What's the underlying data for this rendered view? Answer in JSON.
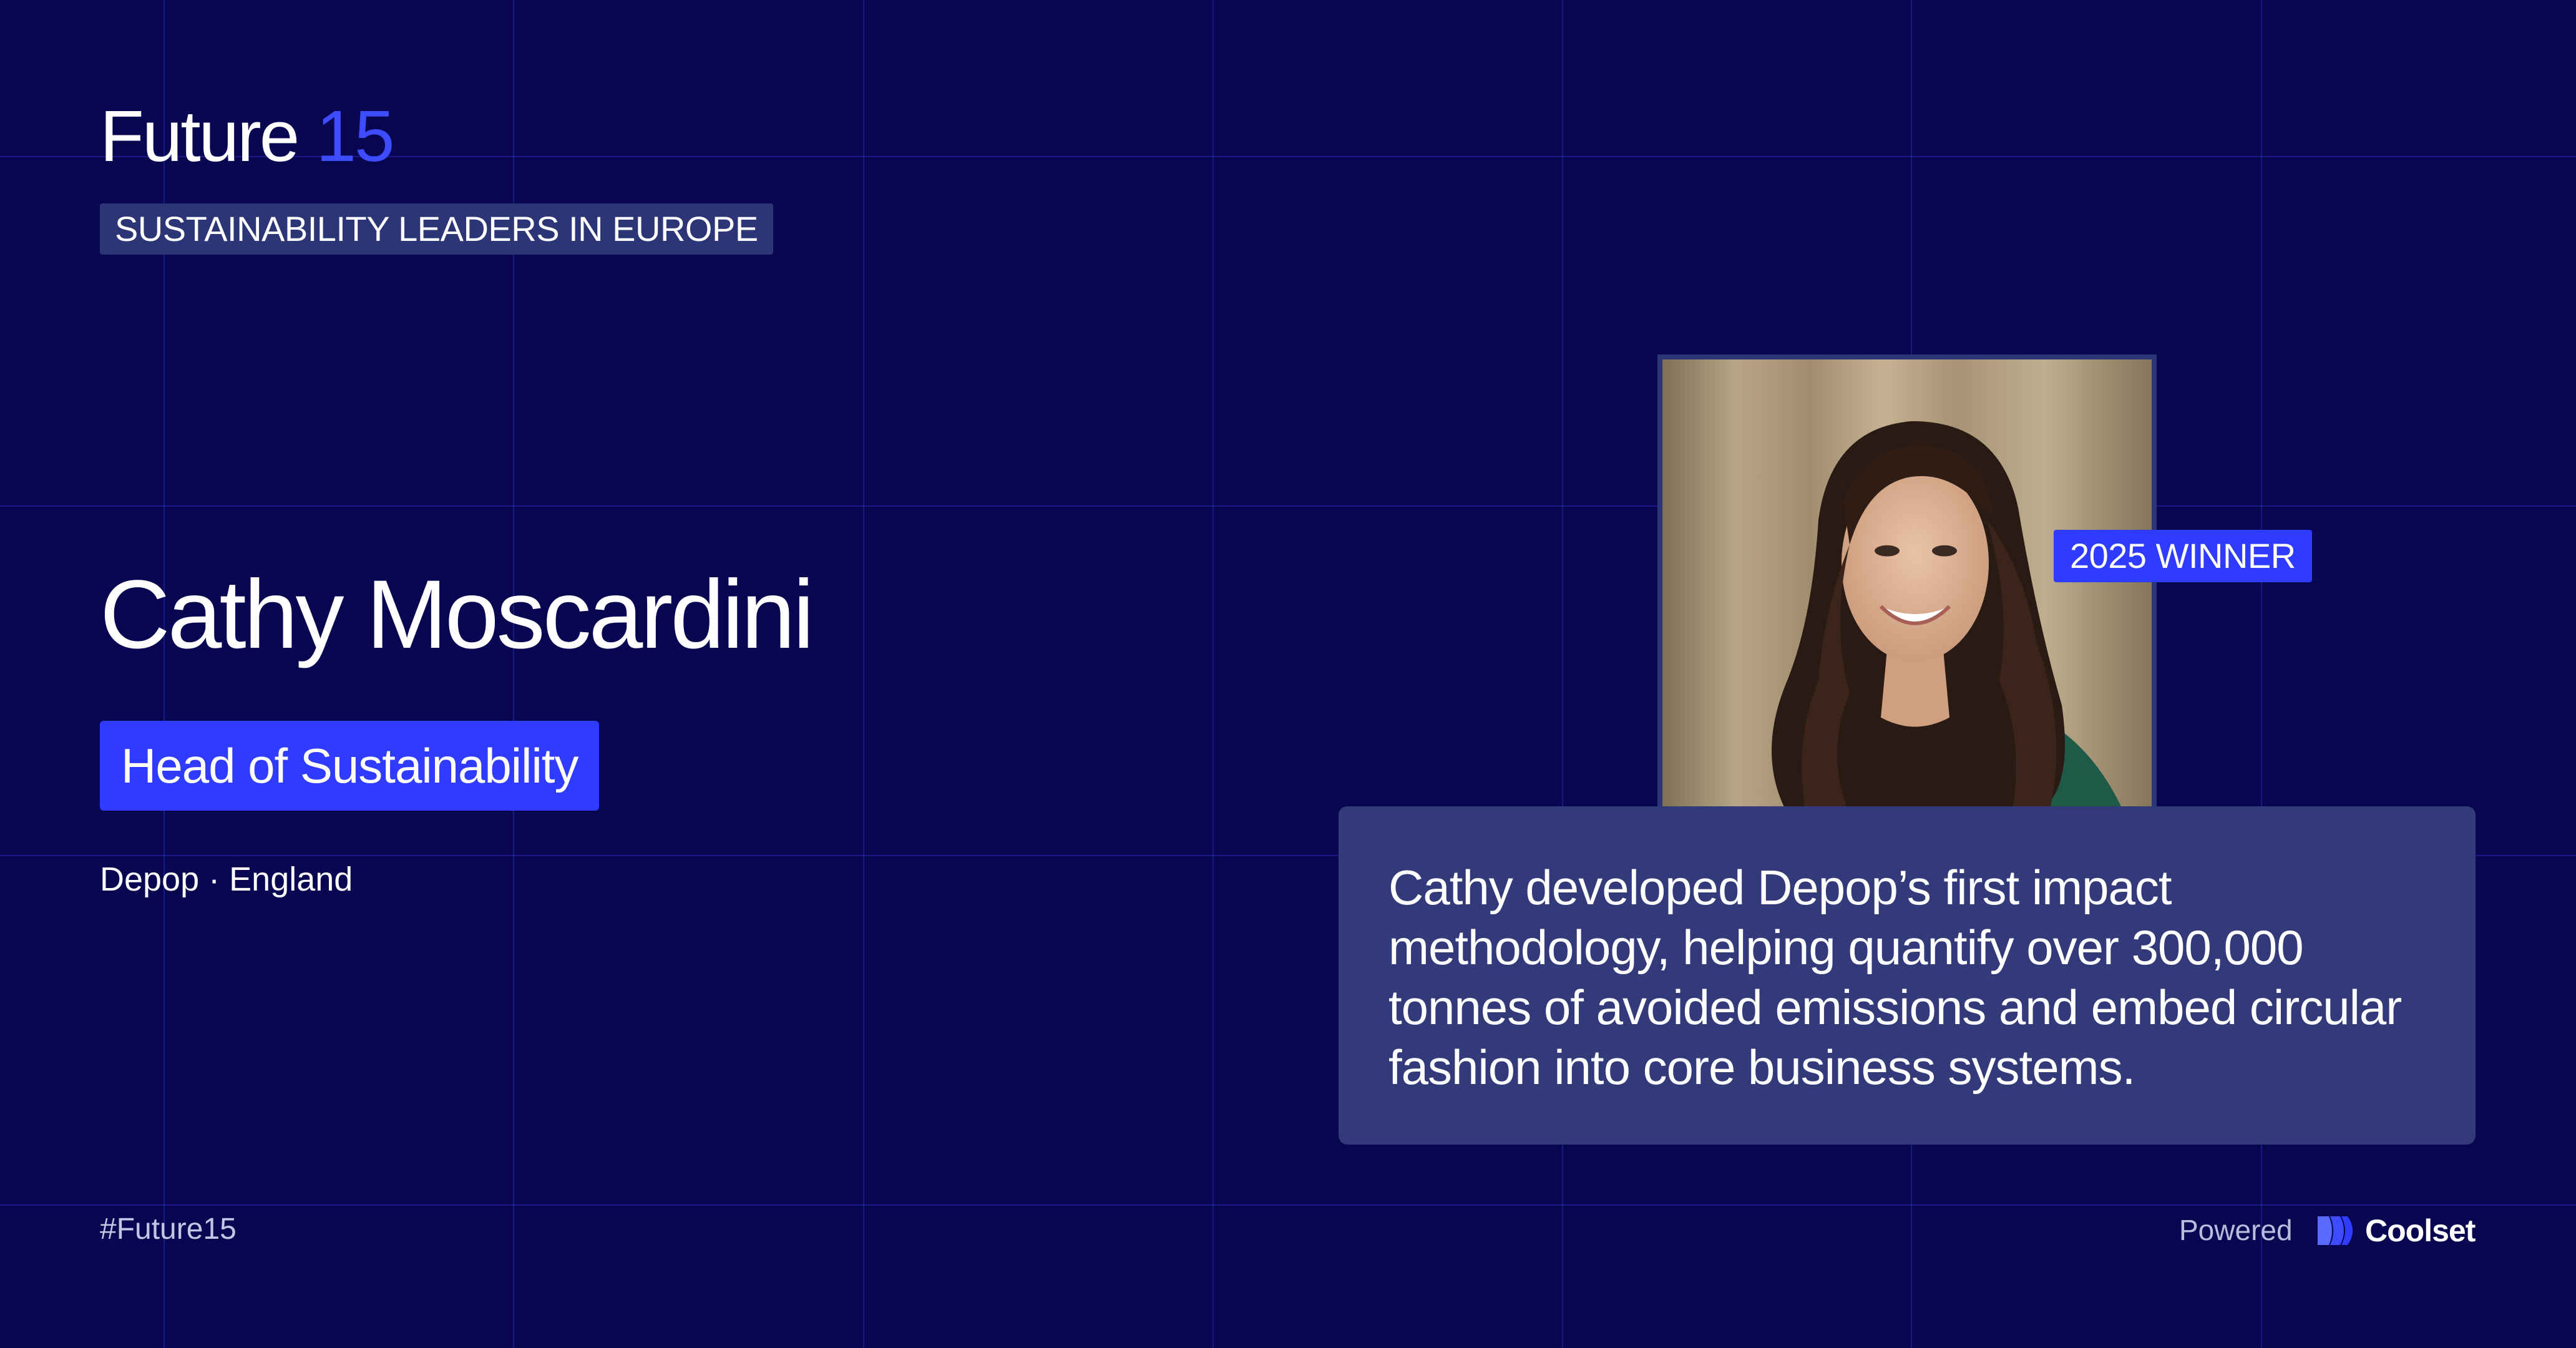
{
  "brand": {
    "word": "Future",
    "number": "15",
    "tagline": "SUSTAINABILITY LEADERS IN EUROPE"
  },
  "person": {
    "name": "Cathy Moscardini",
    "role": "Head of Sustainability",
    "company": "Depop",
    "separator": "·",
    "location": "England"
  },
  "badge": {
    "label": "2025 WINNER"
  },
  "quote": {
    "text": "Cathy developed Depop’s first impact methodology, helping quantify over 300,000 tonnes of avoided emissions and embed circular fashion into core business systems."
  },
  "footer": {
    "hashtag": "#Future15",
    "powered_label": "Powered",
    "partner_name": "Coolset"
  },
  "colors": {
    "background": "#080650",
    "accent": "#2f3cff",
    "card": "#323a7a",
    "tagline_bg": "#2c3576"
  },
  "icons": {
    "partner_logo": "coolset-logo-icon"
  }
}
